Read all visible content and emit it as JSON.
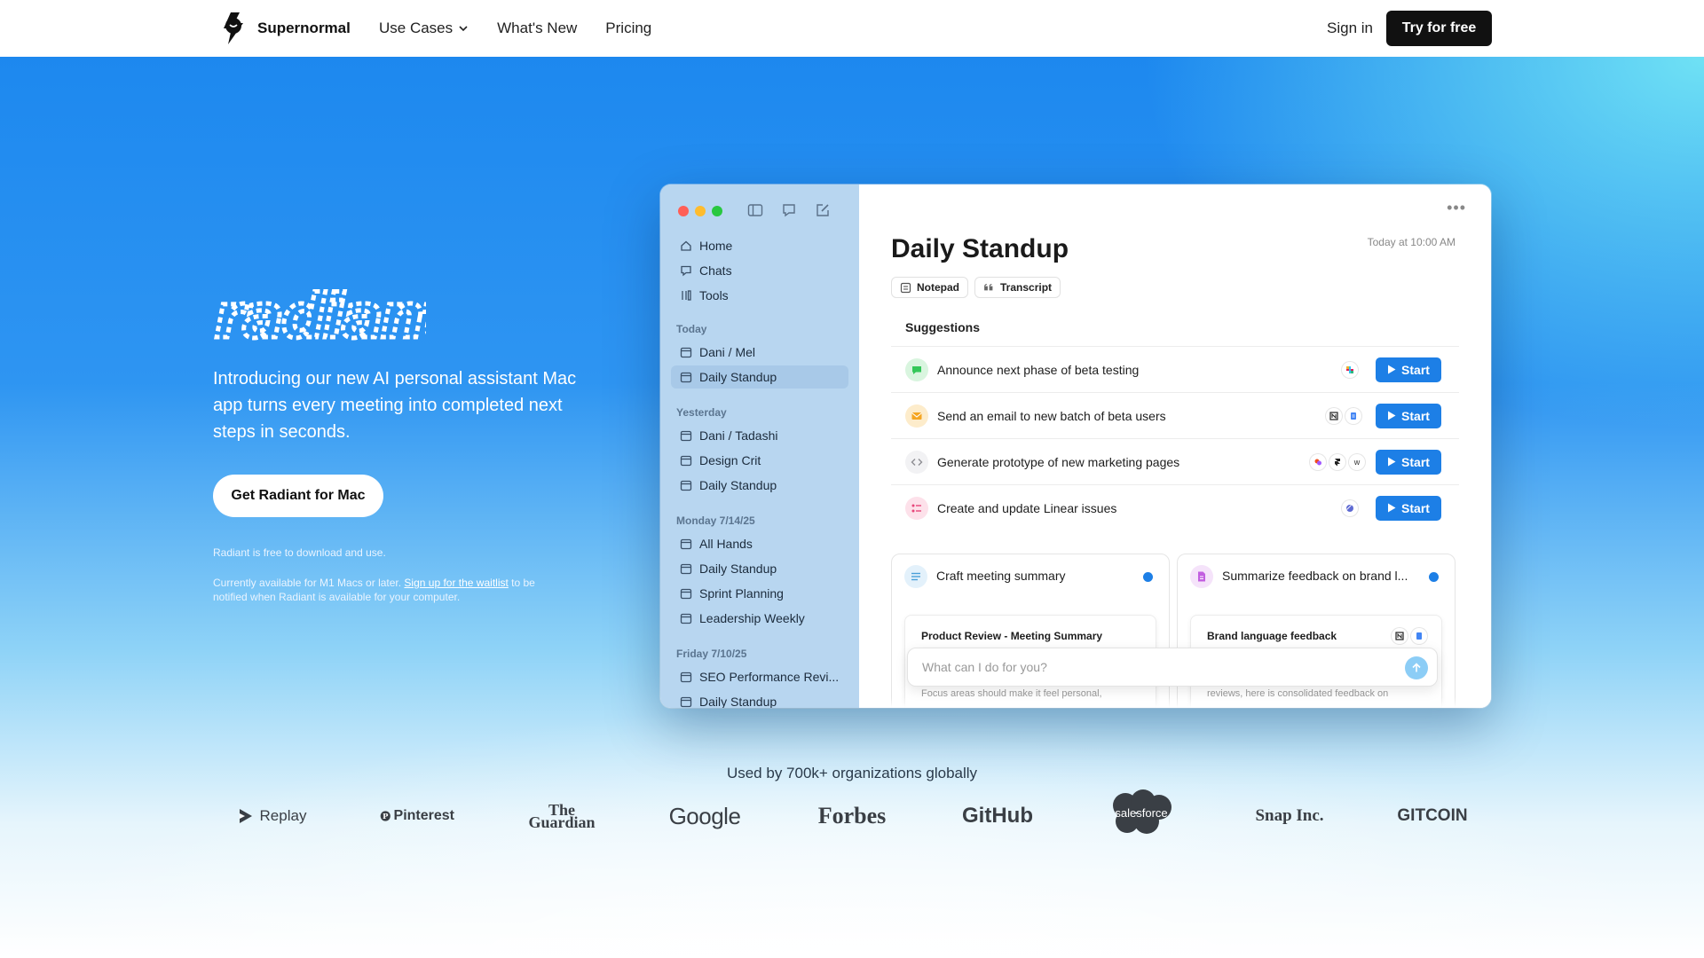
{
  "nav": {
    "brand": "Supernormal",
    "links": [
      "Use Cases",
      "What's New",
      "Pricing"
    ],
    "sign_in": "Sign in",
    "try_button": "Try for free"
  },
  "hero": {
    "product_wordmark": "radiant",
    "intro": "Introducing our new AI personal assistant Mac app turns every meeting into completed next steps in seconds.",
    "cta": "Get Radiant for Mac",
    "free_note": "Radiant is free to download and use.",
    "availability_prefix": "Currently available for M1 Macs or later. ",
    "waitlist_link": "Sign up for the waitlist",
    "availability_suffix": " to be notified when Radiant is available for your computer."
  },
  "app": {
    "sidebar": {
      "nav": [
        "Home",
        "Chats",
        "Tools"
      ],
      "groups": [
        {
          "heading": "Today",
          "items": [
            "Dani / Mel",
            "Daily Standup"
          ]
        },
        {
          "heading": "Yesterday",
          "items": [
            "Dani / Tadashi",
            "Design Crit",
            "Daily Standup"
          ]
        },
        {
          "heading": "Monday 7/14/25",
          "items": [
            "All Hands",
            "Daily Standup",
            "Sprint Planning",
            "Leadership Weekly"
          ]
        },
        {
          "heading": "Friday 7/10/25",
          "items": [
            "SEO Performance Revi...",
            "Daily Standup"
          ]
        }
      ],
      "active_item": "Daily Standup"
    },
    "main": {
      "title": "Daily Standup",
      "timestamp": "Today at 10:00 AM",
      "tabs": [
        "Notepad",
        "Transcript"
      ],
      "suggestions_heading": "Suggestions",
      "suggestions": [
        {
          "text": "Announce next phase of beta testing",
          "icon": "chat-bubble-icon",
          "color": "#34c759",
          "action": "Start"
        },
        {
          "text": "Send an email to new batch of beta users",
          "icon": "envelope-icon",
          "color": "#f5a623",
          "action": "Start"
        },
        {
          "text": "Generate prototype of new marketing pages",
          "icon": "code-icon",
          "color": "#8e8e93",
          "action": "Start"
        },
        {
          "text": "Create and update Linear issues",
          "icon": "checklist-icon",
          "color": "#e8457a",
          "action": "Start"
        }
      ],
      "cards": [
        {
          "title": "Craft meeting summary",
          "inner_title": "Product Review - Meeting Summary",
          "inner_text": "Focus areas should make it feel personal,"
        },
        {
          "title": "Summarize feedback on brand l...",
          "inner_title": "Brand language feedback",
          "inner_text": "reviews, here is consolidated feedback on"
        }
      ],
      "ask_placeholder": "What can I do for you?"
    }
  },
  "social_proof": {
    "heading": "Used by 700k+ organizations globally",
    "logos": [
      "Replay",
      "Pinterest",
      "The Guardian",
      "Google",
      "Forbes",
      "GitHub",
      "salesforce",
      "Snap Inc.",
      "GITCOIN"
    ]
  },
  "colors": {
    "accent_blue": "#1d7fe6",
    "hero_gradient_top": "#1a86ee",
    "sidebar": "#b8d6f0",
    "button_dark": "#111111"
  }
}
